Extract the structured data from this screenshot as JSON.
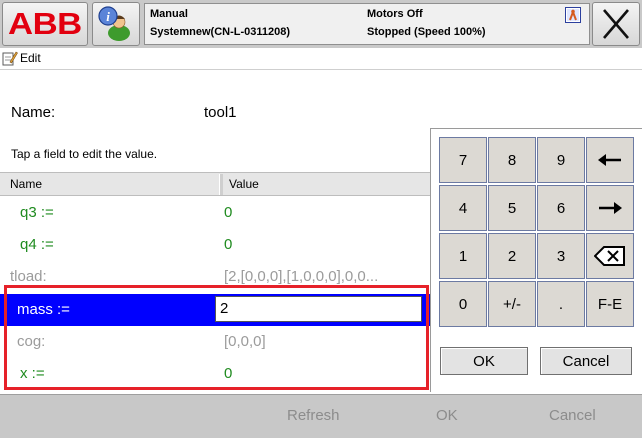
{
  "topbar": {
    "logo_text": "ABB",
    "status": {
      "mode": "Manual",
      "system": "Systemnew(CN-L-0311208)",
      "motors": "Motors Off",
      "state": "Stopped (Speed 100%)"
    }
  },
  "subheader": {
    "title": "Edit"
  },
  "record": {
    "name_label": "Name:",
    "name_value": "tool1",
    "hint": "Tap a field to edit the value."
  },
  "table": {
    "columns": [
      "Name",
      "Value"
    ],
    "rows": [
      {
        "name": "q3 :=",
        "value": "0"
      },
      {
        "name": "q4 :=",
        "value": "0"
      },
      {
        "name": "tload:",
        "value": "[2,[0,0,0],[1,0,0,0],0,0..."
      },
      {
        "name": "mass :=",
        "value": "2"
      },
      {
        "name": "cog:",
        "value": "[0,0,0]"
      },
      {
        "name": "x :=",
        "value": "0"
      }
    ]
  },
  "keypad": {
    "keys": [
      "7",
      "8",
      "9",
      "4",
      "5",
      "6",
      "1",
      "2",
      "3",
      "0",
      "+/-",
      ".",
      "F-E"
    ],
    "ok_label": "OK",
    "cancel_label": "Cancel"
  },
  "bottombar": {
    "refresh_label": "Refresh",
    "ok_label": "OK",
    "cancel_label": "Cancel"
  },
  "colors": {
    "brand_red": "#e2000f",
    "selection_blue": "#0000ff",
    "editable_green": "#1f8b1f",
    "readonly_grey": "#9b9b9b",
    "annotation_red": "#e62129"
  }
}
